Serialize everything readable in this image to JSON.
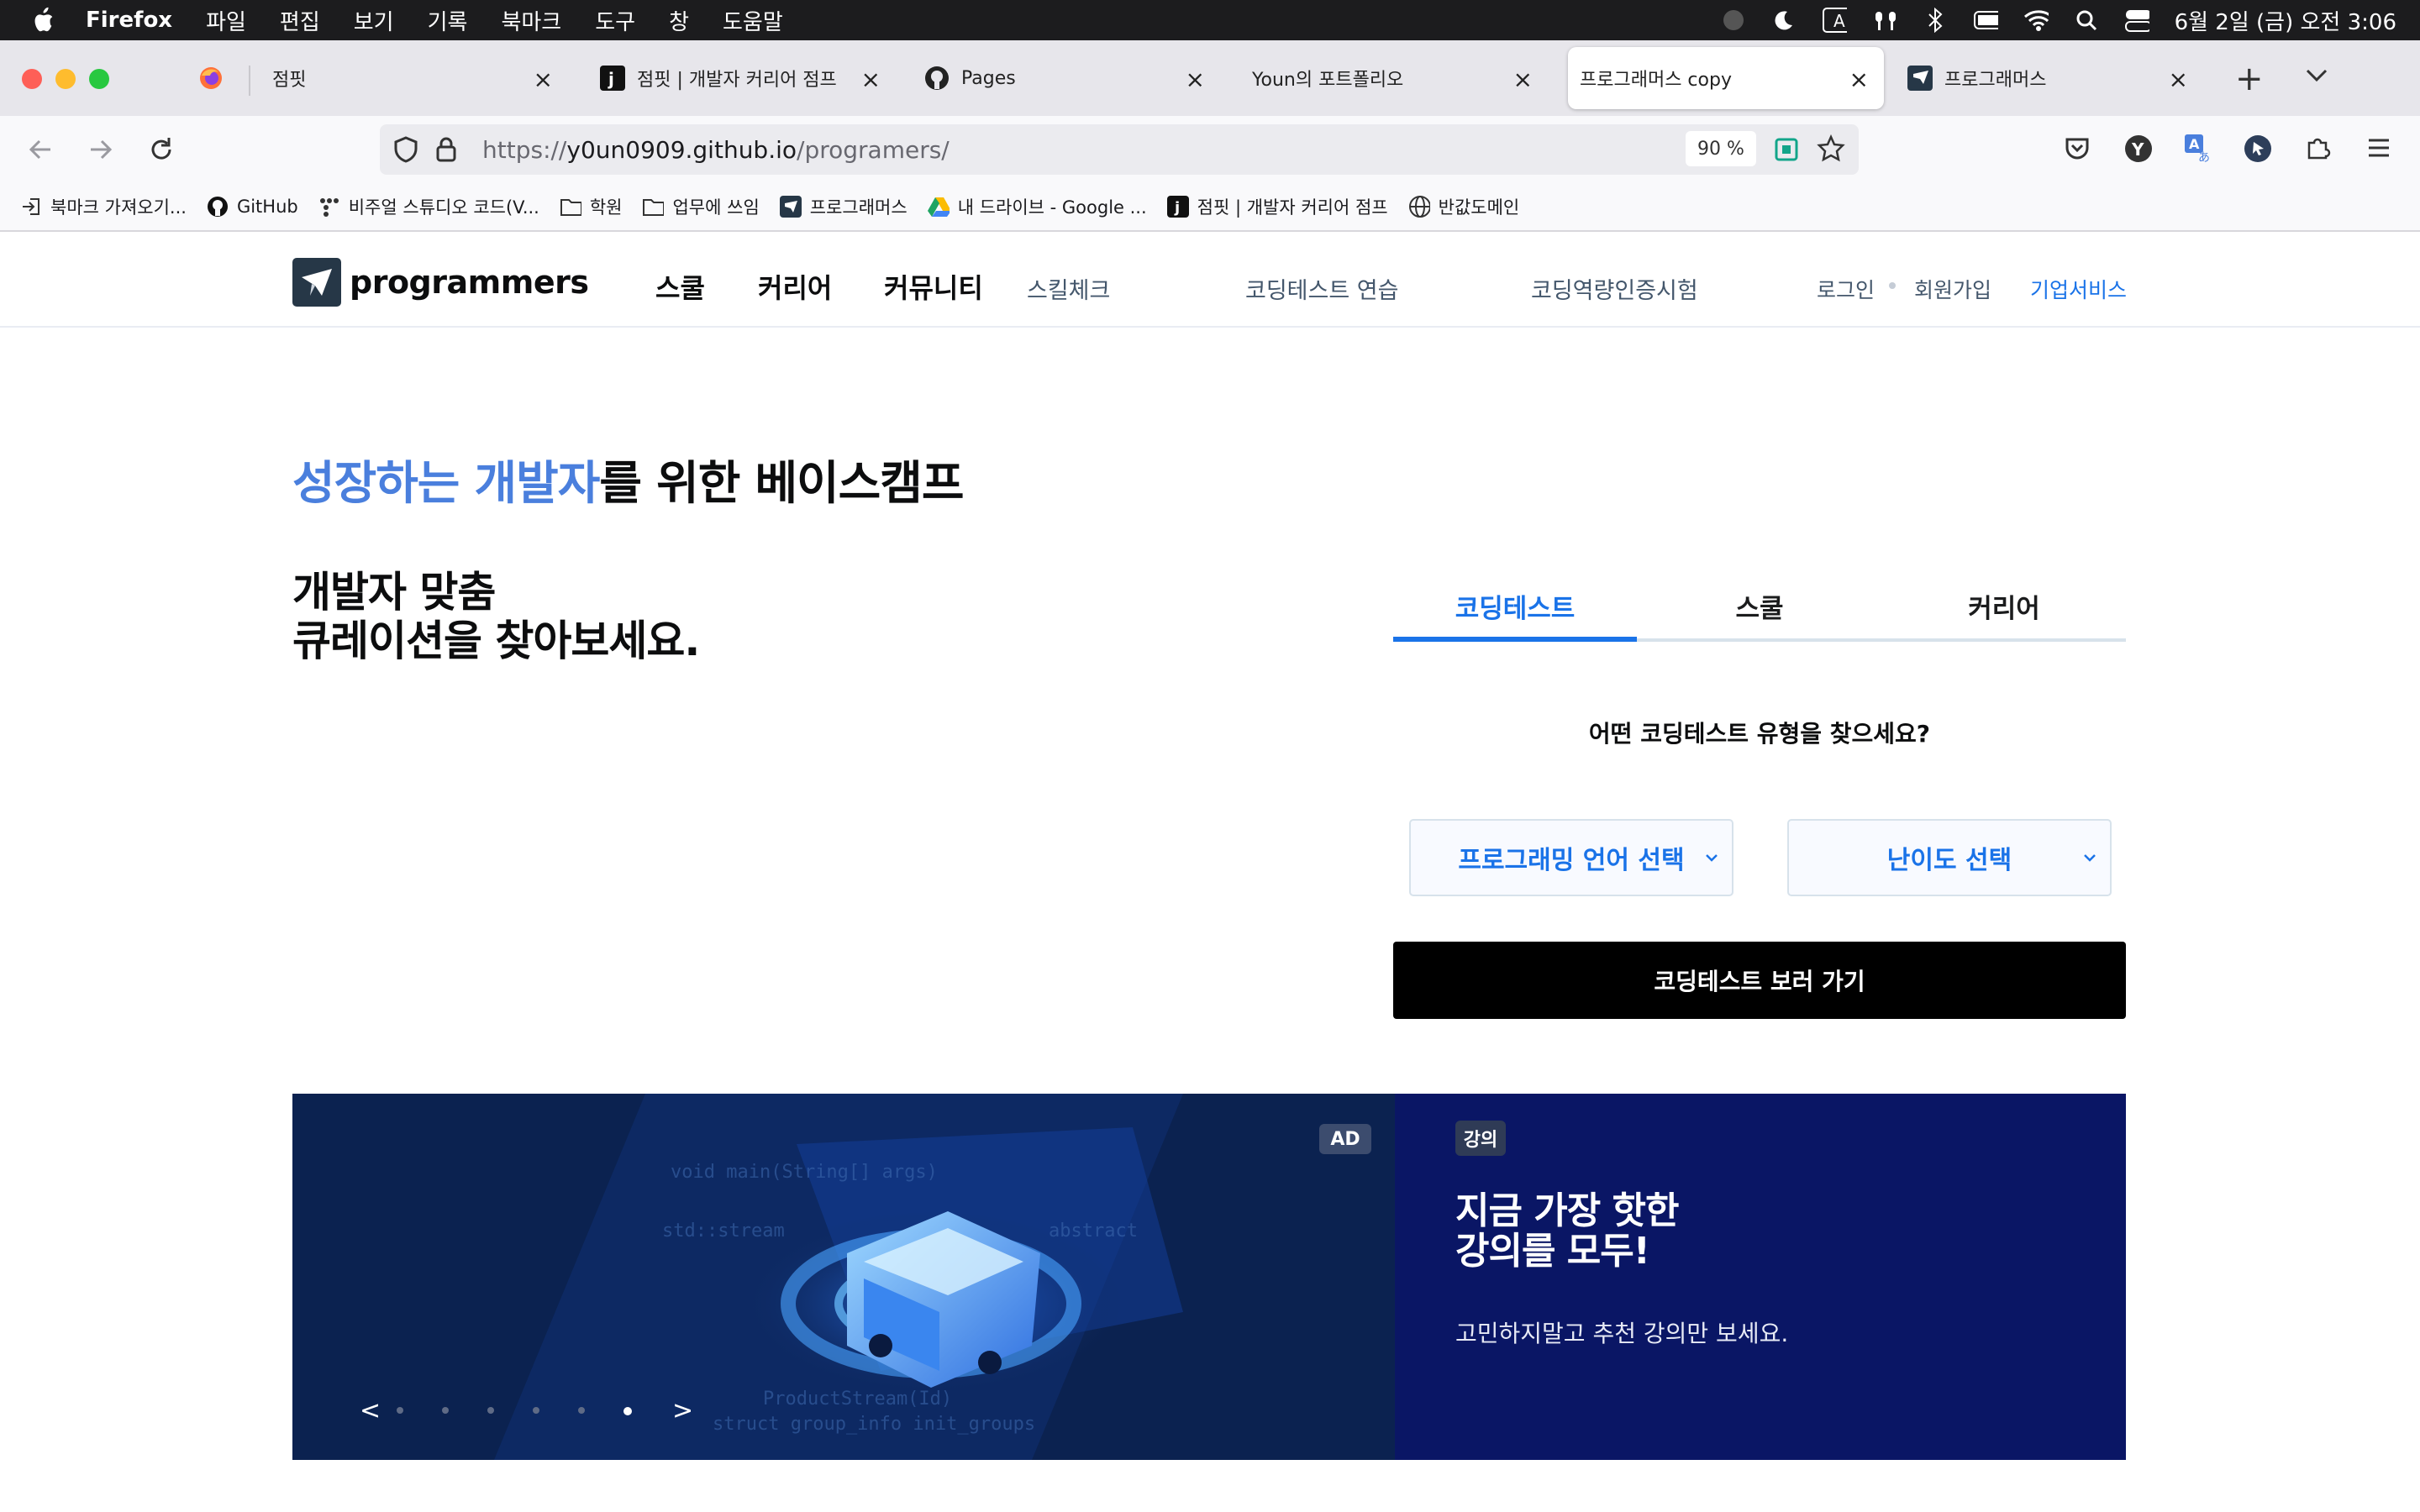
{
  "menubar": {
    "app": "Firefox",
    "items": [
      "파일",
      "편집",
      "보기",
      "기록",
      "북마크",
      "도구",
      "창",
      "도움말"
    ],
    "clock": "6월 2일 (금) 오전 3:06"
  },
  "tabs": [
    {
      "title": "점핏",
      "icon": "firefox-icon"
    },
    {
      "title": "점핏 | 개발자 커리어 점프",
      "icon": "jumpit-icon"
    },
    {
      "title": "Pages",
      "icon": "github-icon"
    },
    {
      "title": "Youn의 포트폴리오",
      "icon": ""
    },
    {
      "title": "프로그래머스 copy",
      "icon": ""
    },
    {
      "title": "프로그래머스",
      "icon": "programmers-icon"
    }
  ],
  "address": {
    "url_prefix": "https://",
    "url_host": "y0un0909.github.io",
    "url_path": "/programers/",
    "zoom": "90 %"
  },
  "bookmarks": [
    {
      "label": "북마크 가져오기...",
      "icon": "import-icon"
    },
    {
      "label": "GitHub",
      "icon": "github-icon"
    },
    {
      "label": "비주얼 스튜디오 코드(V...",
      "icon": "dots-icon"
    },
    {
      "label": "학원",
      "icon": "folder-icon"
    },
    {
      "label": "업무에 쓰임",
      "icon": "folder-icon"
    },
    {
      "label": "프로그래머스",
      "icon": "programmers-icon"
    },
    {
      "label": "내 드라이브 - Google ...",
      "icon": "drive-icon"
    },
    {
      "label": "점핏 | 개발자 커리어 점프",
      "icon": "jumpit-icon"
    },
    {
      "label": "반값도메인",
      "icon": "globe-icon"
    }
  ],
  "site": {
    "logo": "programmers",
    "nav": {
      "school": "스쿨",
      "career": "커리어",
      "community": "커뮤니티",
      "skillcheck": "스킬체크",
      "coding_practice": "코딩테스트 연습",
      "cert": "코딩역량인증시험"
    },
    "login": "로그인",
    "signup": "회원가입",
    "business": "기업서비스",
    "hero_highlight": "성장하는 개발자",
    "hero_rest": "를 위한 베이스캠프",
    "sub_line1": "개발자 맞춤",
    "sub_line2": "큐레이션을 찾아보세요.",
    "curation_tabs": [
      "코딩테스트",
      "스쿨",
      "커리어"
    ],
    "question": "어떤 코딩테스트 유형을 찾으세요?",
    "select_language": "프로그래밍 언어 선택",
    "select_level": "난이도 선택",
    "cta": "코딩테스트 보러 가기",
    "ad_badge": "AD",
    "carousel_prev": "<",
    "carousel_next": ">",
    "carousel_total": 6,
    "carousel_active": 6,
    "promo_badge": "강의",
    "promo_title_1": "지금 가장 핫한",
    "promo_title_2": "강의를 모두!",
    "promo_desc": "고민하지말고 추천 강의만 보세요."
  },
  "colors": {
    "accent": "#1a73e8",
    "hero_highlight": "#4a7fdd",
    "banner_bg": "#0d2656",
    "promo_bg": "#0a1665"
  }
}
